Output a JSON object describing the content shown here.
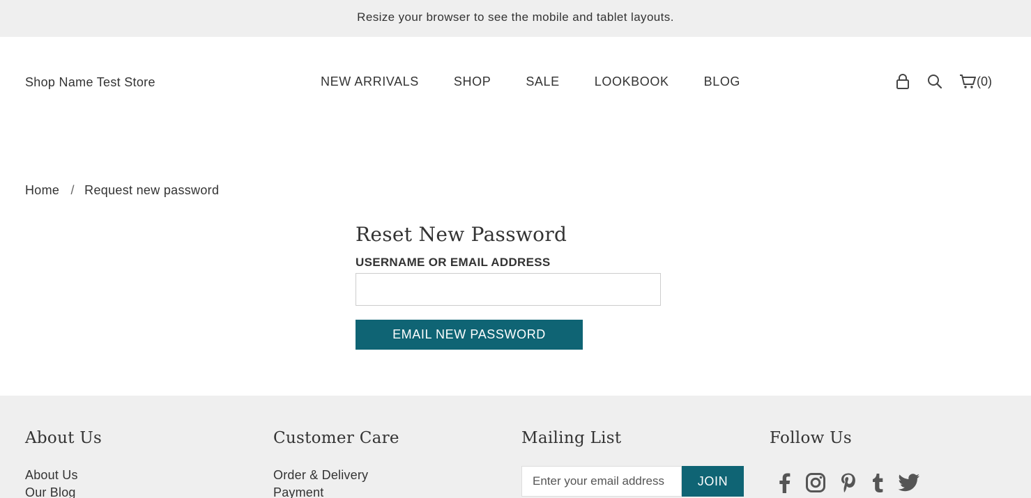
{
  "notice": {
    "text": "Resize your browser to see the mobile and tablet layouts."
  },
  "header": {
    "shop_name": "Shop Name Test Store",
    "nav": [
      {
        "label": "NEW ARRIVALS"
      },
      {
        "label": "SHOP"
      },
      {
        "label": "SALE"
      },
      {
        "label": "LOOKBOOK"
      },
      {
        "label": "BLOG"
      }
    ],
    "icons": {
      "account": "lock-icon",
      "search": "search-icon",
      "cart": "cart-icon"
    },
    "cart_count": "(0)"
  },
  "breadcrumb": {
    "home": "Home",
    "separator": "/",
    "current": "Request new password"
  },
  "form": {
    "title": "Reset New Password",
    "field_label": "USERNAME OR EMAIL ADDRESS",
    "field_value": "",
    "submit_label": "EMAIL NEW PASSWORD"
  },
  "footer": {
    "about": {
      "heading": "About Us",
      "links": [
        "About Us",
        "Our Blog"
      ]
    },
    "care": {
      "heading": "Customer Care",
      "links": [
        "Order & Delivery",
        "Payment"
      ]
    },
    "mailing": {
      "heading": "Mailing List",
      "placeholder": "Enter your email address",
      "join_label": "JOIN"
    },
    "follow": {
      "heading": "Follow Us",
      "icons": [
        "facebook-icon",
        "instagram-icon",
        "pinterest-icon",
        "tumblr-icon",
        "twitter-icon"
      ]
    }
  },
  "colors": {
    "accent": "#0f6474",
    "notice_bg": "#efefef",
    "footer_bg": "#efefef",
    "text": "#333333"
  }
}
